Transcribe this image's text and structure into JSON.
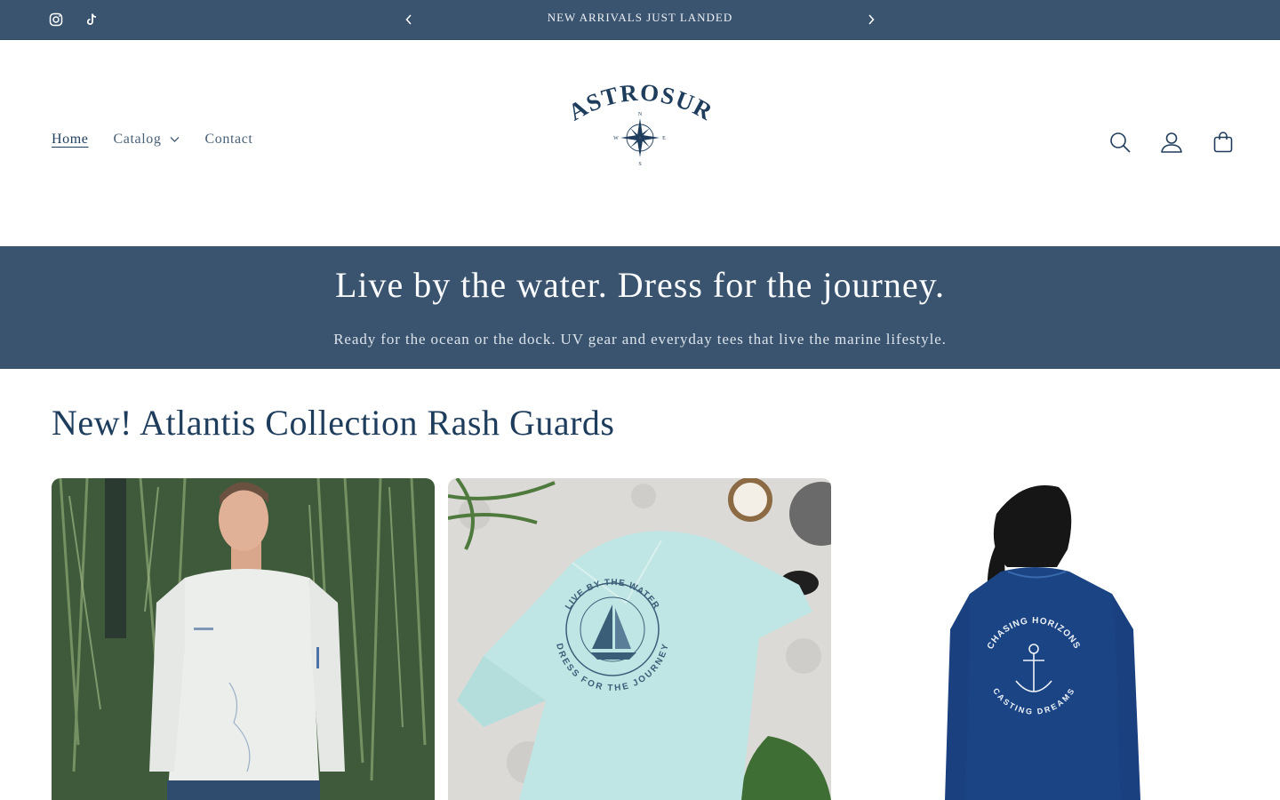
{
  "announcement": {
    "text": "NEW ARRIVALS JUST LANDED",
    "social": [
      "instagram-icon",
      "tiktok-icon"
    ],
    "prev_icon": "chevron-left-icon",
    "next_icon": "chevron-right-icon"
  },
  "header": {
    "logo_text": "ASTROSUR",
    "compass_points": [
      "N",
      "E",
      "S",
      "W"
    ],
    "nav": [
      {
        "label": "Home"
      },
      {
        "label": "Catalog"
      },
      {
        "label": "Contact"
      }
    ],
    "icons": [
      "search-icon",
      "account-icon",
      "cart-icon"
    ]
  },
  "banner": {
    "heading": "Live by the water. Dress for the journey.",
    "subheading": "Ready for the ocean or the dock. UV gear and everyday tees that live the marine lifestyle."
  },
  "collection": {
    "title": "New! Atlantis Collection Rash Guards",
    "products": [
      {
        "garment_color": "white",
        "print_text": ""
      },
      {
        "garment_color": "light-aqua",
        "print_top": "LIVE BY THE WATER",
        "print_bottom": "DRESS FOR THE JOURNEY"
      },
      {
        "garment_color": "navy",
        "print_top": "CHASING HORIZONS",
        "print_bottom": "CASTING DREAMS"
      }
    ]
  },
  "colors": {
    "brand_navy": "#1e3d5c",
    "announcement_bg": "#3a5470",
    "banner_bg": "#3a5470"
  }
}
